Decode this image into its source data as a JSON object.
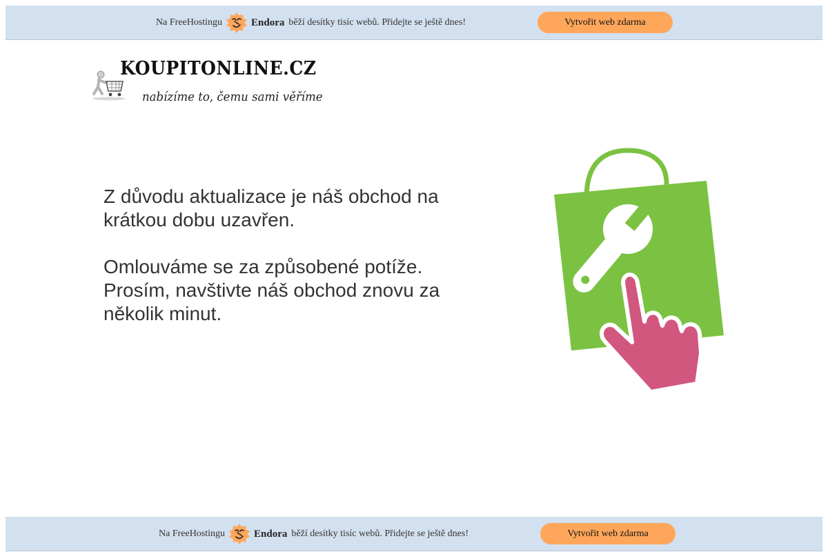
{
  "promo_top": {
    "text_before": "Na FreeHostingu",
    "brand": "Endora",
    "text_after": "běží desítky tisíc webů. Přidejte se ještě dnes!",
    "cta_label": "Vytvořit web zdarma",
    "logo_icon": "endora-badge-icon",
    "accent_color": "#fea75a",
    "bar_color": "#d3e0ef"
  },
  "site": {
    "logo_title": "KOUPITONLINE.CZ",
    "logo_tagline": "nabízíme to, čemu sami věříme",
    "logo_icon": "shopping-cart-figure-icon"
  },
  "maintenance": {
    "line1": "Z důvodu aktualizace je náš obchod na krátkou dobu uzavřen.",
    "line2": "Omlouváme se za způsobené potíže. Prosím, navštivte náš obchod znovu za několik minut.",
    "illustration_icon": "shopping-bag-wrench-pointer-icon",
    "bag_color": "#7cc242",
    "hand_color": "#d1577f"
  },
  "promo_bottom": {
    "text_before": "Na FreeHostingu",
    "brand": "Endora",
    "text_after": "běží desítky tisíc webů. Přidejte se ještě dnes!",
    "cta_label": "Vytvořit web zdarma",
    "logo_icon": "endora-badge-icon"
  }
}
